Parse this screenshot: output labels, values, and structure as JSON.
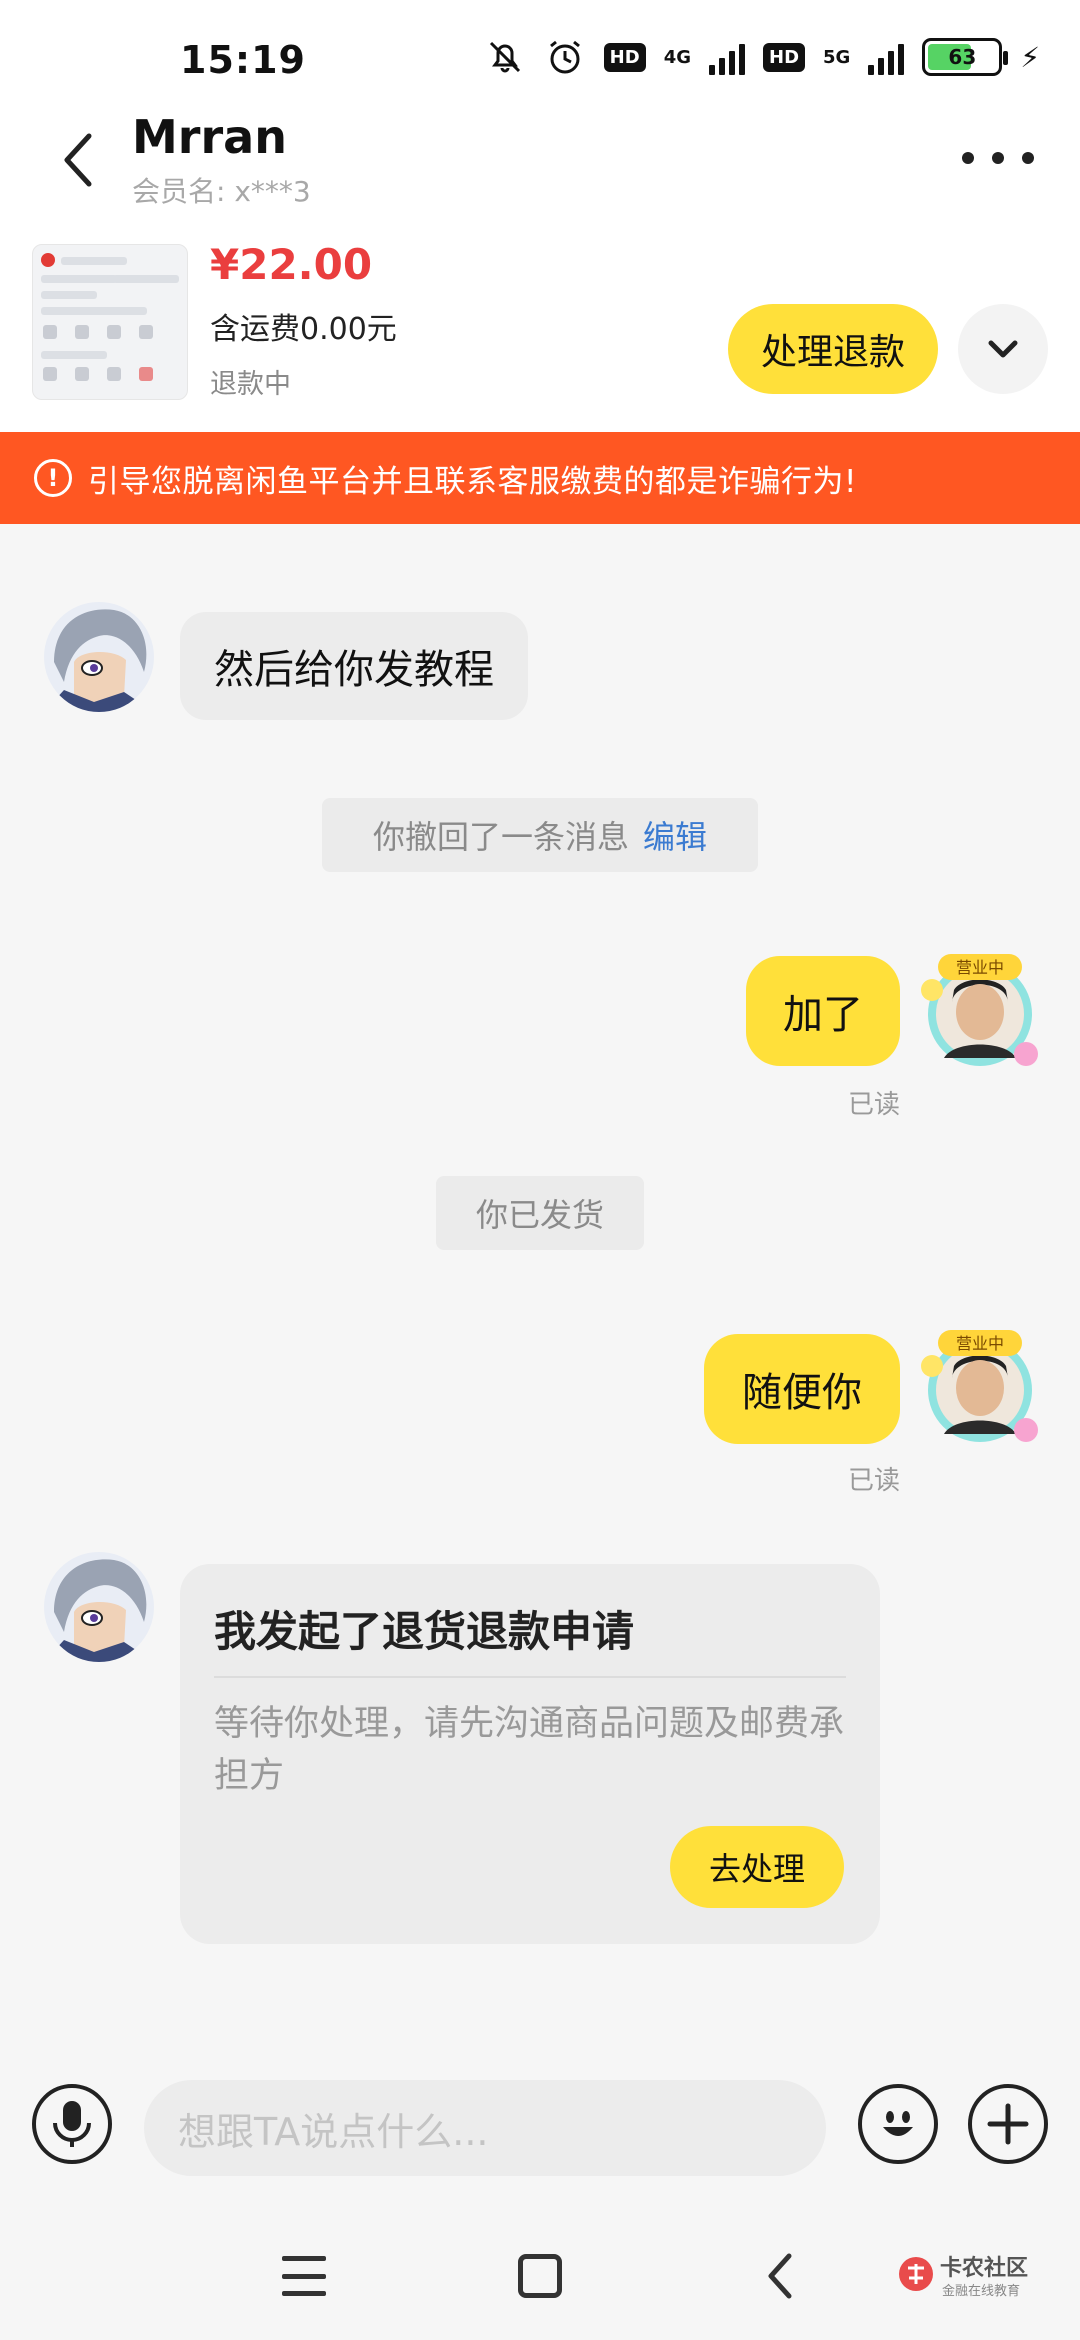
{
  "status_bar": {
    "time": "15:19",
    "hd1": "HD",
    "net1": "4G",
    "hd2": "HD",
    "net2": "5G",
    "battery": "63",
    "battery_color": "#56d364"
  },
  "header": {
    "title": "Mrran",
    "subtitle": "会员名: x***3"
  },
  "product": {
    "price": "¥22.00",
    "shipping": "含运费0.00元",
    "status": "退款中",
    "refund_button": "处理退款"
  },
  "warning": {
    "icon": "!",
    "text": "引导您脱离闲鱼平台并且联系客服缴费的都是诈骗行为!",
    "color": "#ff5722"
  },
  "messages": {
    "m1_text": "然后给你发教程",
    "recall_text": "你撤回了一条消息",
    "recall_edit": "编辑",
    "m2_text": "加了",
    "m2_read": "已读",
    "shipped_text": "你已发货",
    "m3_text": "随便你",
    "m3_read": "已读",
    "card_title": "我发起了退货退款申请",
    "card_body": "等待你处理，请先沟通商品问题及邮费承担方",
    "card_button": "去处理"
  },
  "input": {
    "placeholder": "想跟TA说点什么..."
  },
  "watermark": {
    "name": "卡农社区",
    "sub": "金融在线教育"
  },
  "accent_color": "#ffe03a"
}
